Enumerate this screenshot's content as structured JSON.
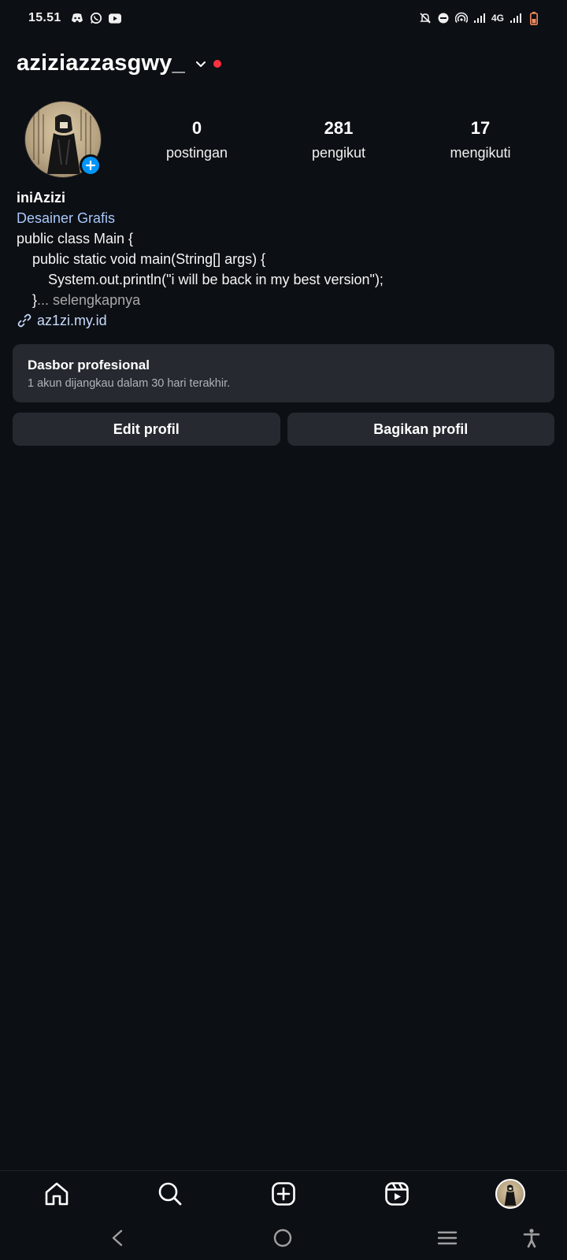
{
  "status_bar": {
    "time": "15.51",
    "network": "4G",
    "left_icons": [
      "discord-icon",
      "whatsapp-icon",
      "youtube-icon"
    ],
    "right_icons": [
      "mute-icon",
      "dnd-icon",
      "hotspot-icon",
      "signal-icon",
      "signal-icon",
      "battery-icon"
    ]
  },
  "header": {
    "username": "aziziazzasgwy_",
    "notification_color": "#ff3040"
  },
  "profile": {
    "stats": [
      {
        "value": "0",
        "label": "postingan"
      },
      {
        "value": "281",
        "label": "pengikut"
      },
      {
        "value": "17",
        "label": "mengikuti"
      }
    ]
  },
  "bio": {
    "display_name": "iniAzizi",
    "category": "Desainer Grafis",
    "lines": [
      "public class Main {",
      "    public static void main(String[] args) {",
      "        System.out.println(\"i will be back in my best version\");",
      "    }"
    ],
    "more_suffix": "... selengkapnya",
    "link": "az1zi.my.id"
  },
  "dashboard": {
    "title": "Dasbor profesional",
    "subtitle": "1 akun dijangkau dalam 30 hari terakhir."
  },
  "buttons": {
    "edit": "Edit profil",
    "share": "Bagikan profil"
  },
  "bottom_nav": [
    "home-icon",
    "search-icon",
    "create-icon",
    "reels-icon",
    "profile-avatar"
  ],
  "colors": {
    "background": "#0c0f14",
    "card": "#262a30",
    "accent_blue": "#0095f6",
    "category_text": "#a8c7fa"
  }
}
